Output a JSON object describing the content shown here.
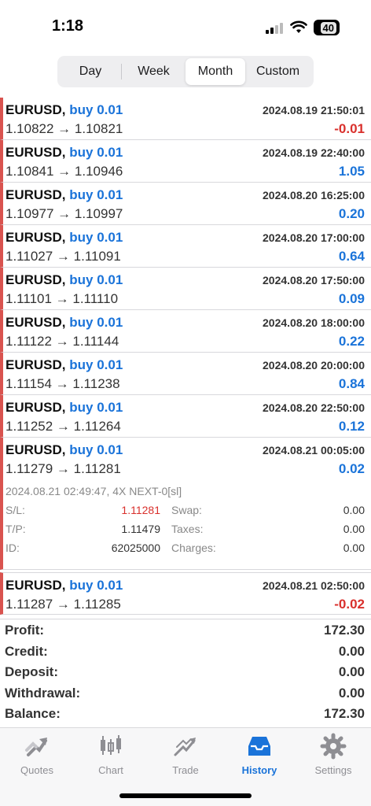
{
  "status_bar": {
    "time": "1:18",
    "battery": "40"
  },
  "period_tabs": [
    {
      "label": "Day",
      "active": false
    },
    {
      "label": "Week",
      "active": false
    },
    {
      "label": "Month",
      "active": true
    },
    {
      "label": "Custom",
      "active": false
    }
  ],
  "deals": [
    {
      "symbol": "EURUSD,",
      "type": "buy 0.01",
      "time": "2024.08.19 21:50:01",
      "prices": "1.10822 → 1.10821",
      "profit": "-0.01"
    },
    {
      "symbol": "EURUSD,",
      "type": "buy 0.01",
      "time": "2024.08.19 22:40:00",
      "prices": "1.10841 → 1.10946",
      "profit": "1.05"
    },
    {
      "symbol": "EURUSD,",
      "type": "buy 0.01",
      "time": "2024.08.20 16:25:00",
      "prices": "1.10977 → 1.10997",
      "profit": "0.20"
    },
    {
      "symbol": "EURUSD,",
      "type": "buy 0.01",
      "time": "2024.08.20 17:00:00",
      "prices": "1.11027 → 1.11091",
      "profit": "0.64"
    },
    {
      "symbol": "EURUSD,",
      "type": "buy 0.01",
      "time": "2024.08.20 17:50:00",
      "prices": "1.11101 → 1.11110",
      "profit": "0.09"
    },
    {
      "symbol": "EURUSD,",
      "type": "buy 0.01",
      "time": "2024.08.20 18:00:00",
      "prices": "1.11122 → 1.11144",
      "profit": "0.22"
    },
    {
      "symbol": "EURUSD,",
      "type": "buy 0.01",
      "time": "2024.08.20 20:00:00",
      "prices": "1.11154 → 1.11238",
      "profit": "0.84"
    },
    {
      "symbol": "EURUSD,",
      "type": "buy 0.01",
      "time": "2024.08.20 22:50:00",
      "prices": "1.11252 → 1.11264",
      "profit": "0.12"
    },
    {
      "symbol": "EURUSD,",
      "type": "buy 0.01",
      "time": "2024.08.21 00:05:00",
      "prices": "1.11279 → 1.11281",
      "profit": "0.02"
    }
  ],
  "expanded_details": {
    "header": "2024.08.21 02:49:47, 4X NEXT-0[sl]",
    "sl_label": "S/L:",
    "sl_value": "1.11281",
    "swap_label": "Swap:",
    "swap_value": "0.00",
    "tp_label": "T/P:",
    "tp_value": "1.11479",
    "taxes_label": "Taxes:",
    "taxes_value": "0.00",
    "id_label": "ID:",
    "id_value": "62025000",
    "charges_label": "Charges:",
    "charges_value": "0.00"
  },
  "last_deal": {
    "symbol": "EURUSD,",
    "type": "buy 0.01",
    "time": "2024.08.21 02:50:00",
    "prices": "1.11287 → 1.11285",
    "profit": "-0.02"
  },
  "summary": [
    {
      "label": "Profit:",
      "value": "172.30"
    },
    {
      "label": "Credit:",
      "value": "0.00"
    },
    {
      "label": "Deposit:",
      "value": "0.00"
    },
    {
      "label": "Withdrawal:",
      "value": "0.00"
    },
    {
      "label": "Balance:",
      "value": "172.30"
    }
  ],
  "tabbar": [
    {
      "label": "Quotes",
      "icon": "quotes-icon",
      "active": false
    },
    {
      "label": "Chart",
      "icon": "chart-icon",
      "active": false
    },
    {
      "label": "Trade",
      "icon": "trade-icon",
      "active": false
    },
    {
      "label": "History",
      "icon": "history-icon",
      "active": true
    },
    {
      "label": "Settings",
      "icon": "gear-icon",
      "active": false
    }
  ],
  "colors": {
    "accent": "#1a73d9",
    "loss": "#d9302c",
    "rail": "#d9534f"
  }
}
